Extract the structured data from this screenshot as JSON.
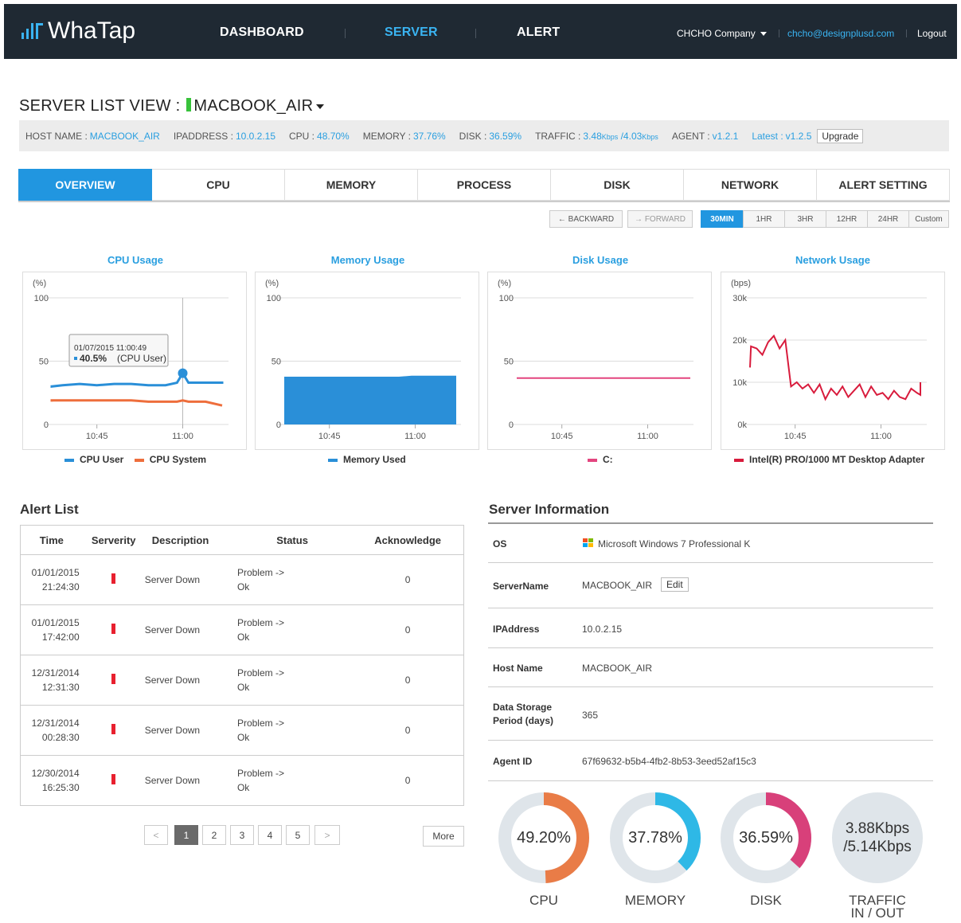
{
  "header": {
    "logo_text": "WhaTap",
    "nav": [
      "DASHBOARD",
      "SERVER",
      "ALERT"
    ],
    "company": "CHCHO Company",
    "email": "chcho@designplusd.com",
    "logout": "Logout",
    "brand_color": "#3ab4f2"
  },
  "page": {
    "title_prefix": "SERVER LIST VIEW :",
    "server_name": "MACBOOK_AIR"
  },
  "info": {
    "host_label": "HOST NAME :",
    "host": "MACBOOK_AIR",
    "ip_label": "IPADDRESS :",
    "ip": "10.0.2.15",
    "cpu_label": "CPU :",
    "cpu": "48.70%",
    "mem_label": "MEMORY :",
    "mem": "37.76%",
    "disk_label": "DISK :",
    "disk": "36.59%",
    "traffic_label": "TRAFFIC :",
    "traffic_in": "3.48",
    "traffic_in_unit": "Kbps",
    "traffic_out": " /4.03",
    "traffic_out_unit": "Kbps",
    "agent_label": "AGENT :",
    "agent": "v1.2.1",
    "latest_label": "Latest :",
    "latest": "v1.2.5",
    "upgrade": "Upgrade"
  },
  "tabs": [
    "OVERVIEW",
    "CPU",
    "MEMORY",
    "PROCESS",
    "DISK",
    "NETWORK",
    "ALERT SETTING"
  ],
  "time_controls": {
    "backward": "← BACKWARD",
    "forward": "→ FORWARD",
    "ranges": [
      "30MIN",
      "1HR",
      "3HR",
      "12HR",
      "24HR",
      "Custom"
    ]
  },
  "charts": {
    "cpu": {
      "title": "CPU Usage",
      "unit": "(%)",
      "y_ticks": [
        "100",
        "50",
        "0"
      ],
      "x_ticks": [
        "10:45",
        "11:00"
      ],
      "tooltip_time": "01/07/2015 11:00:49",
      "tooltip_value": "40.5%",
      "tooltip_series": "(CPU User)",
      "legend": [
        "CPU User",
        "CPU System"
      ]
    },
    "memory": {
      "title": "Memory Usage",
      "unit": "(%)",
      "y_ticks": [
        "100",
        "50",
        "0"
      ],
      "x_ticks": [
        "10:45",
        "11:00"
      ],
      "legend": [
        "Memory Used"
      ]
    },
    "disk": {
      "title": "Disk Usage",
      "unit": "(%)",
      "y_ticks": [
        "100",
        "50",
        "0"
      ],
      "x_ticks": [
        "10:45",
        "11:00"
      ],
      "legend": [
        "C:"
      ]
    },
    "network": {
      "title": "Network Usage",
      "unit": "(bps)",
      "y_ticks": [
        "30k",
        "20k",
        "10k",
        "0k"
      ],
      "x_ticks": [
        "10:45",
        "11:00"
      ],
      "legend": [
        "Intel(R) PRO/1000 MT Desktop Adapter"
      ]
    }
  },
  "chart_data": [
    {
      "type": "line",
      "title": "CPU Usage",
      "ylabel": "(%)",
      "ylim": [
        0,
        100
      ],
      "x": [
        "10:33",
        "10:36",
        "10:39",
        "10:42",
        "10:45",
        "10:48",
        "10:51",
        "10:54",
        "10:57",
        "10:59",
        "11:00",
        "11:01",
        "11:04",
        "11:07",
        "11:09"
      ],
      "series": [
        {
          "name": "CPU User",
          "color": "#2a8fd8",
          "values": [
            31,
            30,
            31,
            32,
            31,
            32,
            32,
            31,
            31,
            33,
            40.5,
            33,
            33,
            33,
            34
          ]
        },
        {
          "name": "CPU System",
          "color": "#ee6e3c",
          "values": [
            18,
            19,
            19,
            19,
            19,
            19,
            19,
            18,
            18,
            18,
            19,
            18,
            18,
            15,
            15
          ]
        }
      ]
    },
    {
      "type": "area",
      "title": "Memory Usage",
      "ylabel": "(%)",
      "ylim": [
        0,
        100
      ],
      "x": [
        "10:33",
        "10:45",
        "11:00",
        "11:09"
      ],
      "series": [
        {
          "name": "Memory Used",
          "color": "#2a8fd8",
          "values": [
            37.7,
            37.7,
            38.5,
            38.5
          ]
        }
      ]
    },
    {
      "type": "line",
      "title": "Disk Usage",
      "ylabel": "(%)",
      "ylim": [
        0,
        100
      ],
      "x": [
        "10:33",
        "10:45",
        "11:00",
        "11:09"
      ],
      "series": [
        {
          "name": "C:",
          "color": "#e3457f",
          "values": [
            36.6,
            36.6,
            36.6,
            36.6
          ]
        }
      ]
    },
    {
      "type": "line",
      "title": "Network Usage",
      "ylabel": "(bps)",
      "ylim": [
        0,
        30000
      ],
      "x": [
        "10:36",
        "10:37",
        "10:38",
        "10:39",
        "10:40",
        "10:41",
        "10:42",
        "10:43",
        "10:44",
        "10:45",
        "10:46",
        "10:47",
        "10:48",
        "10:49",
        "10:50",
        "10:51",
        "10:52",
        "10:53",
        "10:54",
        "10:55",
        "10:56",
        "10:57",
        "10:58",
        "10:59",
        "11:00",
        "11:01",
        "11:02",
        "11:03",
        "11:04",
        "11:05",
        "11:06",
        "11:07",
        "11:08",
        "11:09"
      ],
      "series": [
        {
          "name": "Intel(R) PRO/1000 MT Desktop Adapter",
          "color": "#d81b3c",
          "values": [
            13500,
            18500,
            18000,
            16500,
            19500,
            21000,
            18000,
            20000,
            9000,
            10000,
            8500,
            9500,
            7500,
            9500,
            6000,
            8500,
            7000,
            9000,
            6500,
            8000,
            9500,
            6500,
            9000,
            7000,
            7500,
            6000,
            8000,
            6500,
            6000,
            8500,
            7500,
            7000,
            8000,
            10000
          ]
        }
      ]
    }
  ],
  "alerts": {
    "title": "Alert List",
    "headers": [
      "Time",
      "Serverity",
      "Description",
      "Status",
      "Acknowledge"
    ],
    "rows": [
      {
        "date": "01/01/2015",
        "time": "21:24:30",
        "desc": "Server Down",
        "status1": "Problem ->",
        "status2": "Ok",
        "ack": "0"
      },
      {
        "date": "01/01/2015",
        "time": "17:42:00",
        "desc": "Server Down",
        "status1": "Problem ->",
        "status2": "Ok",
        "ack": "0"
      },
      {
        "date": "12/31/2014",
        "time": "12:31:30",
        "desc": "Server Down",
        "status1": "Problem ->",
        "status2": "Ok",
        "ack": "0"
      },
      {
        "date": "12/31/2014",
        "time": "00:28:30",
        "desc": "Server Down",
        "status1": "Problem ->",
        "status2": "Ok",
        "ack": "0"
      },
      {
        "date": "12/30/2014",
        "time": "16:25:30",
        "desc": "Server Down",
        "status1": "Problem ->",
        "status2": "Ok",
        "ack": "0"
      }
    ],
    "pages": [
      "<",
      "1",
      "2",
      "3",
      "4",
      "5",
      ">"
    ],
    "more": "More"
  },
  "server_info": {
    "title": "Server Information",
    "os_label": "OS",
    "os": "Microsoft Windows 7 Professional K",
    "name_label": "ServerName",
    "name": "MACBOOK_AIR",
    "edit": "Edit",
    "ip_label": "IPAddress",
    "ip": "10.0.2.15",
    "host_label": "Host Name",
    "host": "MACBOOK_AIR",
    "storage_label_1": "Data Storage",
    "storage_label_2": "Period (days)",
    "storage": "365",
    "agent_label": "Agent ID",
    "agent": "67f69632-b5b4-4fb2-8b53-3eed52af15c3"
  },
  "gauges": [
    {
      "label": "CPU",
      "text": "49.20%",
      "fraction": 0.492,
      "color": "#e97c47"
    },
    {
      "label": "MEMORY",
      "text": "37.78%",
      "fraction": 0.3778,
      "color": "#2eb8e6"
    },
    {
      "label": "DISK",
      "text": "36.59%",
      "fraction": 0.3659,
      "color": "#d8407a"
    }
  ],
  "traffic_gauge": {
    "line1": "3.88Kbps",
    "line2": "/5.14Kbps",
    "label1": "TRAFFIC",
    "label2": "IN / OUT"
  }
}
